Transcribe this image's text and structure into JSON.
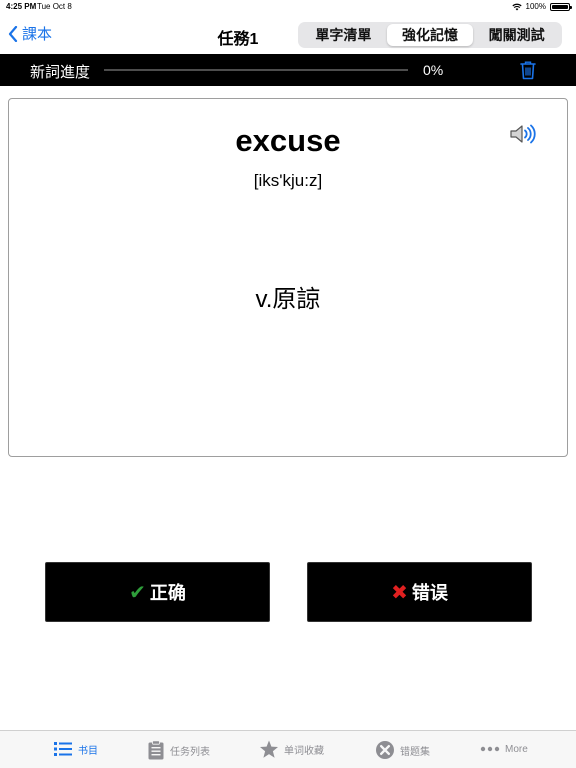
{
  "status": {
    "time": "4:25 PM",
    "date": "Tue Oct 8",
    "battery": "100%"
  },
  "nav": {
    "back_label": "課本",
    "title": "任務1",
    "segments": [
      {
        "label": "單字清單"
      },
      {
        "label": "強化記憶",
        "selected": true
      },
      {
        "label": "闖關測試"
      }
    ]
  },
  "progress": {
    "label": "新詞進度",
    "value": "0%",
    "fraction": 0
  },
  "card": {
    "word": "excuse",
    "phonetic": "[iks'kju:z]",
    "meaning": "v.原諒"
  },
  "buttons": {
    "correct_label": "正确",
    "wrong_label": "错误"
  },
  "tabs": [
    {
      "label": "书目",
      "icon": "list-icon",
      "active": true
    },
    {
      "label": "任务列表",
      "icon": "clipboard-icon"
    },
    {
      "label": "单词收藏",
      "icon": "star-icon"
    },
    {
      "label": "错题集",
      "icon": "x-circle-icon"
    },
    {
      "label": "More",
      "icon": "more-icon"
    }
  ],
  "colors": {
    "accent": "#1a73e8",
    "check": "#2e9e3a",
    "cross": "#e02020"
  }
}
